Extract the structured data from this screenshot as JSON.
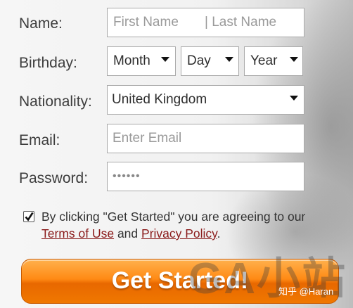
{
  "form": {
    "name_label": "Name:",
    "first_name_placeholder": "First Name",
    "last_name_placeholder": "| Last Name",
    "birthday_label": "Birthday:",
    "month_value": "Month",
    "day_value": "Day",
    "year_value": "Year",
    "nationality_label": "Nationality:",
    "nationality_value": "United Kingdom",
    "email_label": "Email:",
    "email_placeholder": "Enter Email",
    "password_label": "Password:",
    "password_value": "••••••"
  },
  "agreement": {
    "checked": true,
    "text_before": "By clicking \"Get Started\" you are agreeing to our ",
    "terms_link": "Terms of Use",
    "and_text": " and ",
    "privacy_link": "Privacy Policy",
    "text_after": "."
  },
  "submit": {
    "label": "Get Started!"
  },
  "watermark": {
    "main": "GA小站",
    "credit": "知乎 @Haran"
  },
  "colors": {
    "button_orange": "#ff8a14",
    "link_red": "#8a1a1a"
  }
}
